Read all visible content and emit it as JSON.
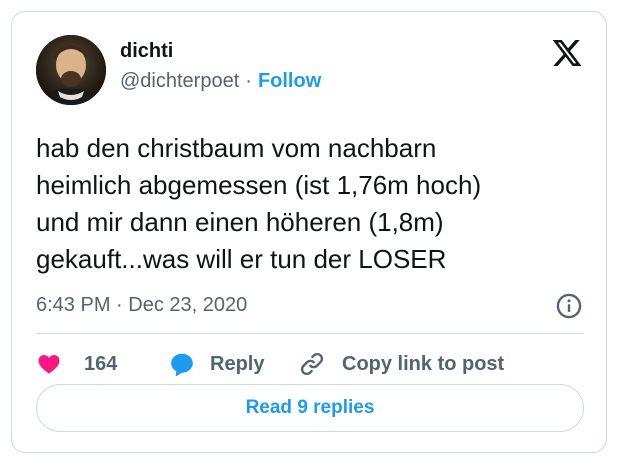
{
  "author": {
    "display_name": "dichti",
    "handle": "@dichterpoet",
    "separator": "·",
    "follow_label": "Follow",
    "avatar_icon": "portrait-avatar"
  },
  "brand": {
    "logo_icon": "x-logo-icon",
    "color": "#0f1419"
  },
  "tweet": {
    "lines": [
      "hab den christbaum vom nachbarn",
      "heimlich abgemessen (ist 1,76m hoch)",
      "und mir dann einen höheren (1,8m)",
      "gekauft...was will er tun der LOSER"
    ],
    "timestamp": "6:43 PM · Dec 23, 2020"
  },
  "actions": {
    "like_count": "164",
    "reply_label": "Reply",
    "copy_label": "Copy link to post"
  },
  "read_replies_label": "Read 9 replies",
  "colors": {
    "accent": "#1d9bf0",
    "like": "#f91880",
    "text": "#0f1419",
    "muted": "#536471",
    "border": "#cfd9de"
  }
}
